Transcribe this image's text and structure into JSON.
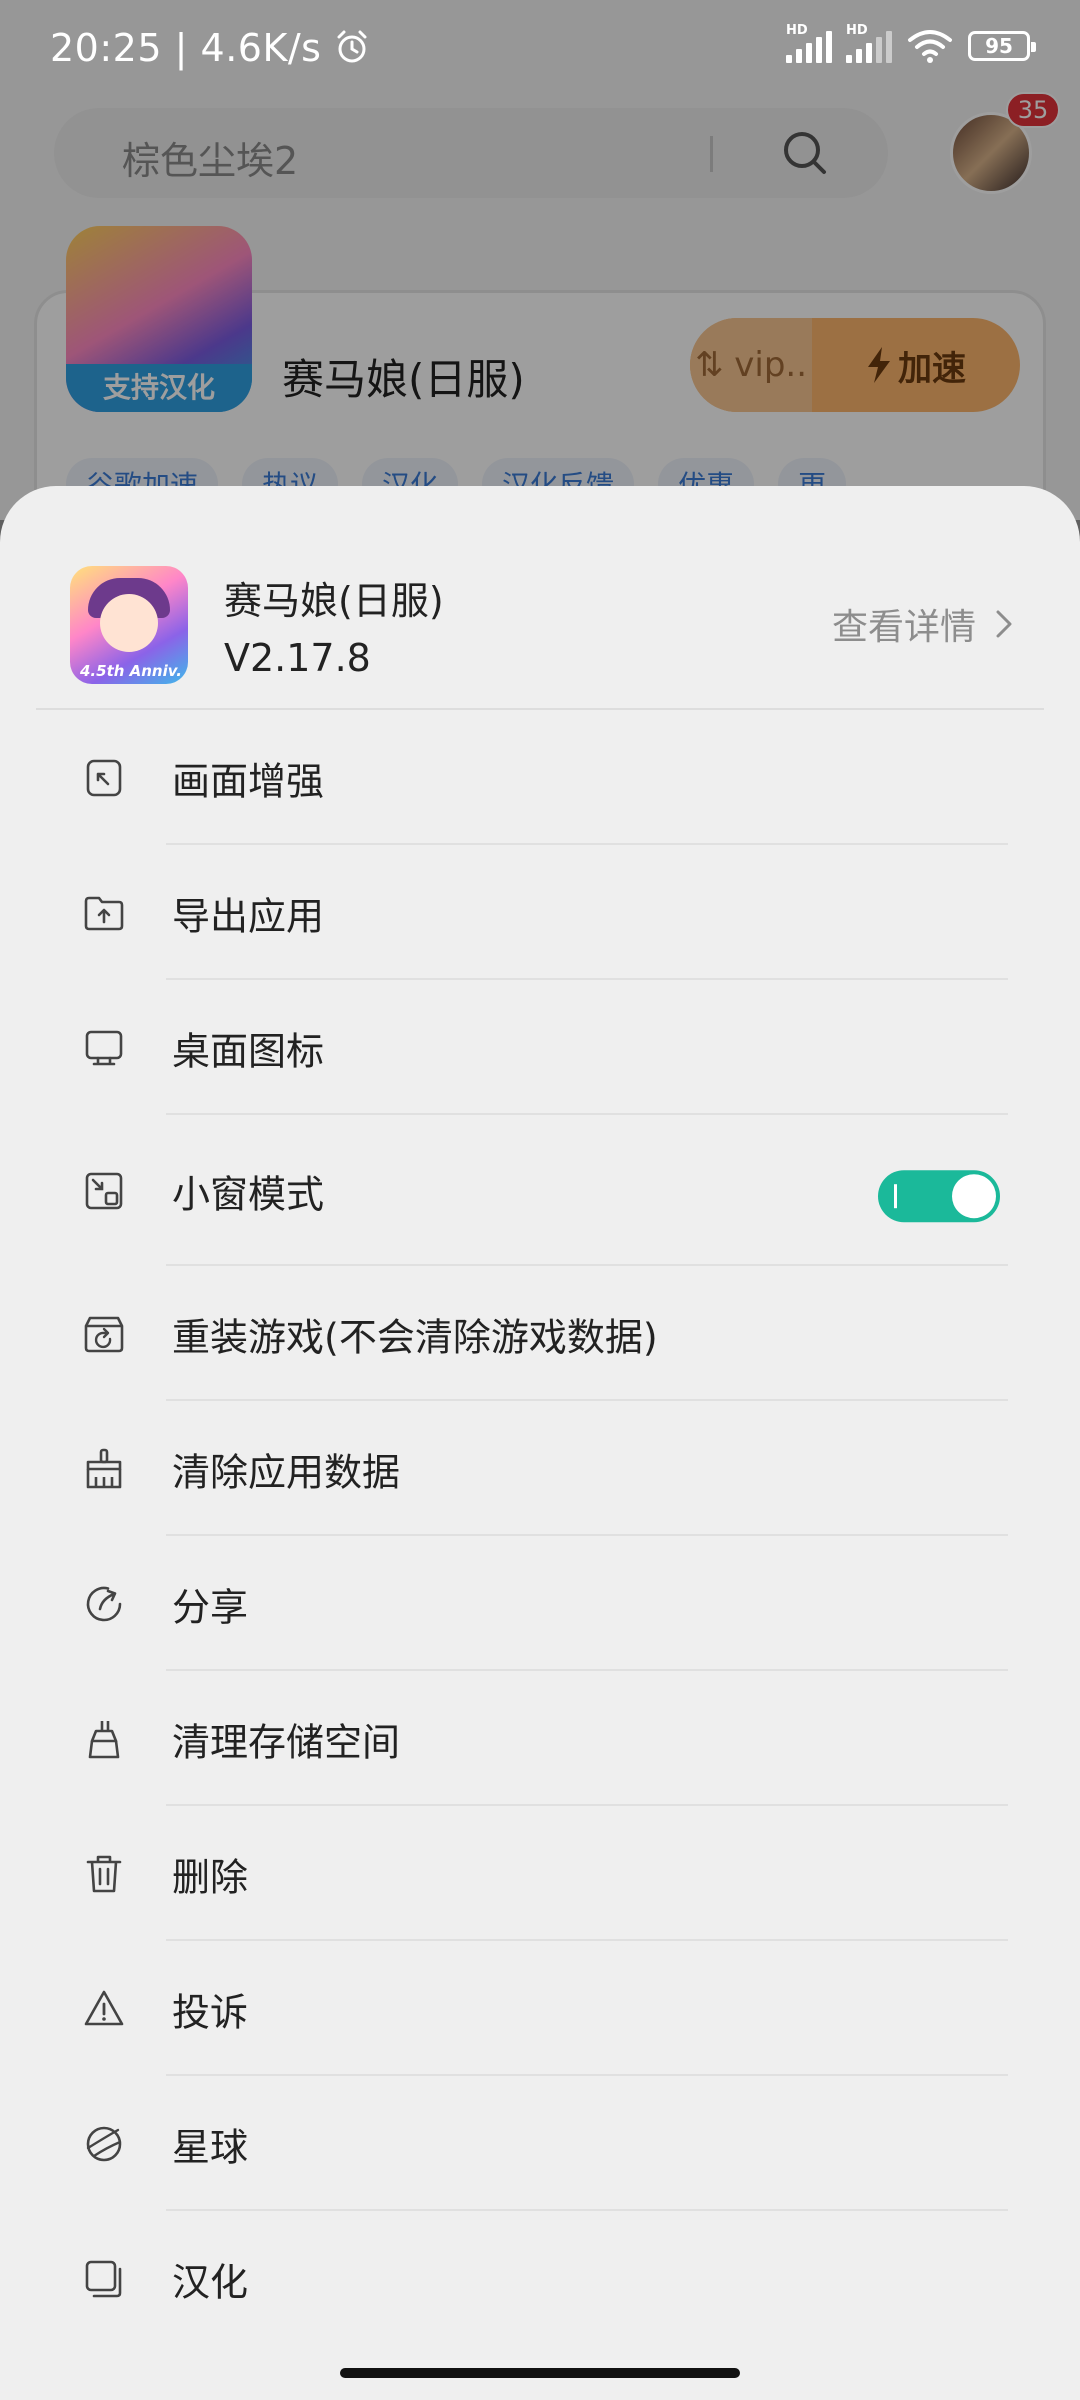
{
  "status_bar": {
    "time": "20:25",
    "separator": "|",
    "net_speed": "4.6K/s",
    "battery": "95",
    "signal_tag": "HD"
  },
  "search": {
    "placeholder": "棕色尘埃2"
  },
  "avatar": {
    "badge_count": "35"
  },
  "card": {
    "title": "赛马娘(日服)",
    "icon_label": "支持汉化",
    "vip_label": "⇅ vip..",
    "speed_label": "加速",
    "tags": [
      "谷歌加速",
      "热议",
      "汉化",
      "汉化反馈",
      "优惠",
      "更"
    ]
  },
  "sheet": {
    "app_name": "赛马娘(日服)",
    "app_version": "V2.17.8",
    "details_label": "查看详情",
    "icon_badge_text": "4.5th Anniv.",
    "menu": [
      {
        "label": "画面增强",
        "icon": "image-enhance-icon"
      },
      {
        "label": "导出应用",
        "icon": "folder-export-icon"
      },
      {
        "label": "桌面图标",
        "icon": "desktop-monitor-icon"
      },
      {
        "label": "小窗模式",
        "icon": "small-window-icon",
        "toggle_on": true
      },
      {
        "label": "重装游戏(不会清除游戏数据)",
        "icon": "reinstall-icon"
      },
      {
        "label": "清除应用数据",
        "icon": "broom-icon"
      },
      {
        "label": "分享",
        "icon": "share-icon"
      },
      {
        "label": "清理存储空间",
        "icon": "brush-clean-icon"
      },
      {
        "label": "删除",
        "icon": "trash-icon"
      },
      {
        "label": "投诉",
        "icon": "warning-icon"
      },
      {
        "label": "星球",
        "icon": "planet-icon"
      },
      {
        "label": "汉化",
        "icon": "copy-icon"
      }
    ]
  },
  "colors": {
    "toggle_on": "#1bb99a",
    "badge_red": "#e2323b",
    "speed_orange": "#fcb56c",
    "sheet_bg": "#efefef"
  }
}
